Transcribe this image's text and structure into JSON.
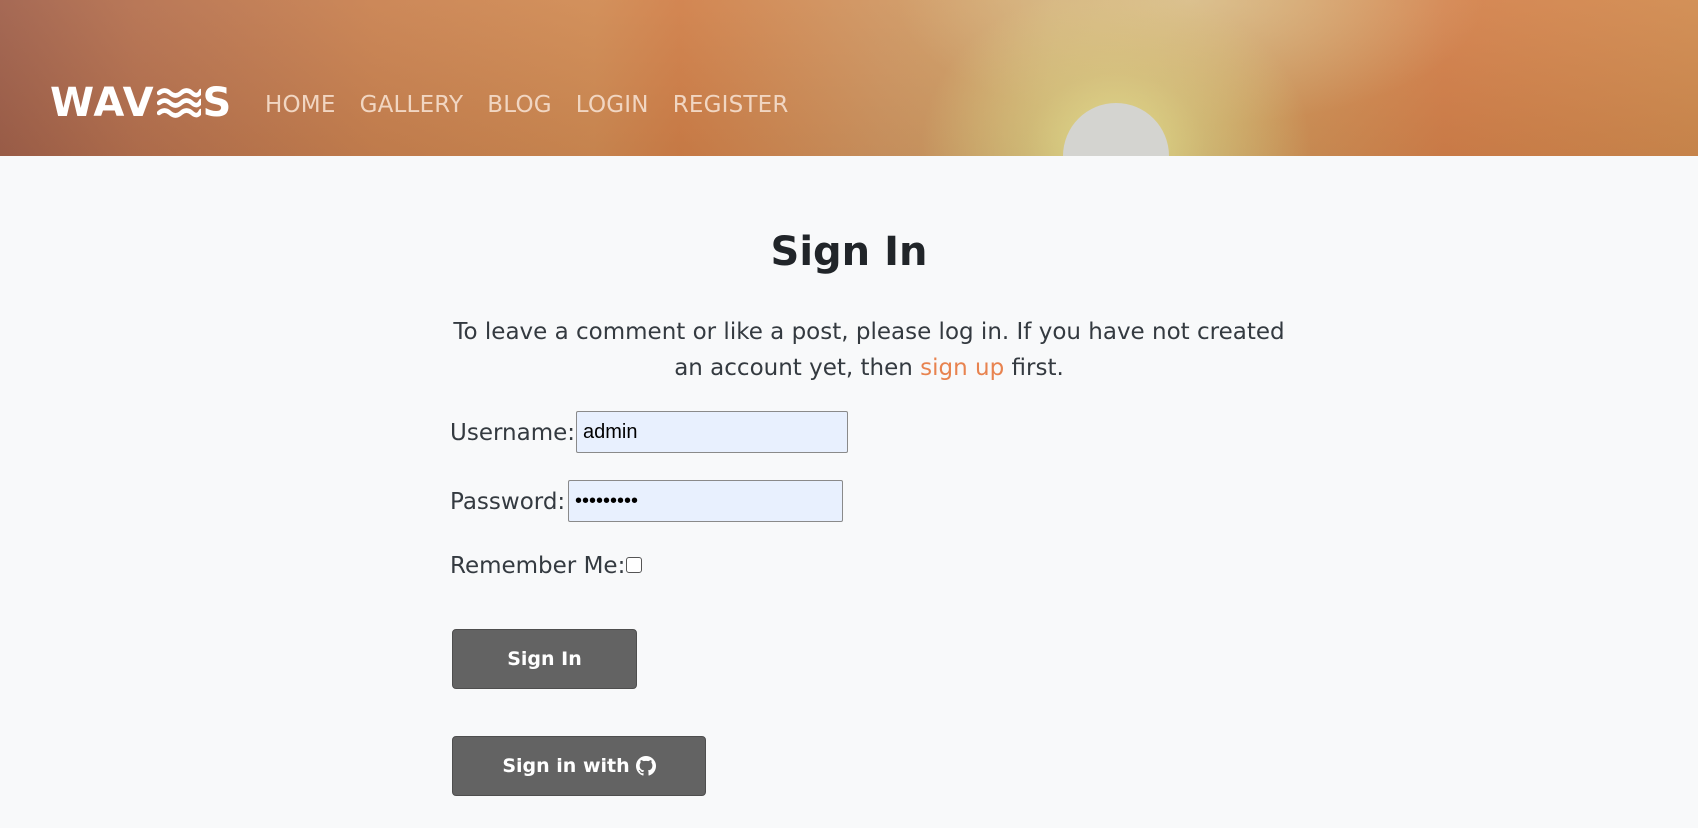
{
  "header": {
    "logo": {
      "text_left": "WAV",
      "text_right": "S",
      "icon": "waves-icon"
    },
    "nav": [
      {
        "label": "HOME"
      },
      {
        "label": "GALLERY"
      },
      {
        "label": "BLOG"
      },
      {
        "label": "LOGIN"
      },
      {
        "label": "REGISTER"
      }
    ]
  },
  "main": {
    "title": "Sign In",
    "intro": {
      "before": "To leave a comment or like a post, please log in. If you have not created an account yet, then ",
      "link": "sign up",
      "after": " first."
    },
    "form": {
      "username_label": "Username:",
      "username_value": "admin",
      "password_label": "Password:",
      "password_value": "•••••••••",
      "remember_label": "Remember Me:",
      "remember_checked": false,
      "signin_button": "Sign In",
      "github_button": "Sign in with",
      "github_icon": "github-icon"
    }
  },
  "colors": {
    "page_bg": "#f8f9fa",
    "accent": "#e8834f",
    "button_bg": "#636363",
    "input_bg": "#e8f0fe",
    "nav_text": "#f1d6c2"
  }
}
